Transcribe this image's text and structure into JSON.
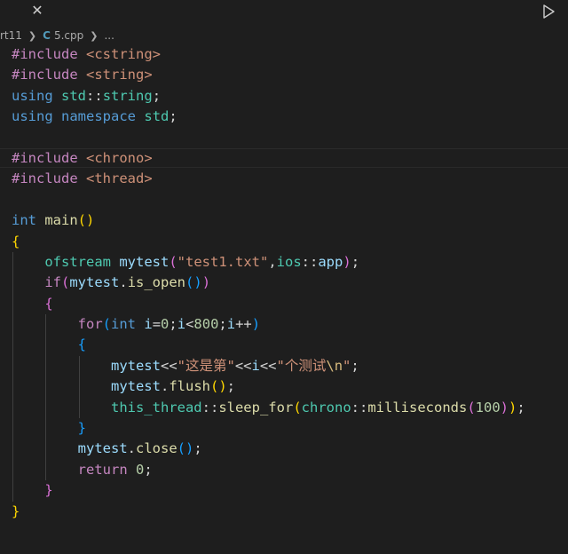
{
  "tabbar": {
    "close_glyph": "✕",
    "run_icon": "run-triangle-icon"
  },
  "breadcrumb": {
    "folder": "rt11",
    "file_icon": "C",
    "file": "5.cpp",
    "ellipsis": "..."
  },
  "colors": {
    "background": "#1e1e1e",
    "preprocessor": "#c586c0",
    "include_path": "#ce9178",
    "keyword": "#569cd6",
    "type": "#4ec9b0",
    "function": "#dcdcaa",
    "variable": "#9cdcfe",
    "string": "#ce9178",
    "number": "#b5cea8",
    "bracket_level1": "#ffd700",
    "bracket_level2": "#da70d6",
    "bracket_level3": "#179fff"
  },
  "code": {
    "lines": [
      [
        {
          "t": "#include",
          "c": "pp"
        },
        {
          "t": " ",
          "c": "op"
        },
        {
          "t": "<cstring>",
          "c": "inc"
        }
      ],
      [
        {
          "t": "#include",
          "c": "pp"
        },
        {
          "t": " ",
          "c": "op"
        },
        {
          "t": "<string>",
          "c": "inc"
        }
      ],
      [
        {
          "t": "using",
          "c": "kw"
        },
        {
          "t": " ",
          "c": "op"
        },
        {
          "t": "std",
          "c": "type"
        },
        {
          "t": "::",
          "c": "op"
        },
        {
          "t": "string",
          "c": "type"
        },
        {
          "t": ";",
          "c": "op"
        }
      ],
      [
        {
          "t": "using",
          "c": "kw"
        },
        {
          "t": " ",
          "c": "op"
        },
        {
          "t": "namespace",
          "c": "kw"
        },
        {
          "t": " ",
          "c": "op"
        },
        {
          "t": "std",
          "c": "type"
        },
        {
          "t": ";",
          "c": "op"
        }
      ],
      [],
      [
        {
          "t": "#include",
          "c": "pp"
        },
        {
          "t": " ",
          "c": "op"
        },
        {
          "t": "<chrono>",
          "c": "inc"
        }
      ],
      [
        {
          "t": "#include",
          "c": "pp"
        },
        {
          "t": " ",
          "c": "op"
        },
        {
          "t": "<thread>",
          "c": "inc"
        }
      ],
      [],
      [
        {
          "t": "int",
          "c": "kw"
        },
        {
          "t": " ",
          "c": "op"
        },
        {
          "t": "main",
          "c": "fn"
        },
        {
          "t": "()",
          "c": "b1"
        }
      ],
      [
        {
          "t": "{",
          "c": "b1"
        }
      ],
      [
        {
          "t": "    ",
          "c": "op"
        },
        {
          "t": "ofstream",
          "c": "type"
        },
        {
          "t": " ",
          "c": "op"
        },
        {
          "t": "mytest",
          "c": "var"
        },
        {
          "t": "(",
          "c": "b2"
        },
        {
          "t": "\"test1.txt\"",
          "c": "str"
        },
        {
          "t": ",",
          "c": "op"
        },
        {
          "t": "ios",
          "c": "type"
        },
        {
          "t": "::",
          "c": "op"
        },
        {
          "t": "app",
          "c": "var"
        },
        {
          "t": ")",
          "c": "b2"
        },
        {
          "t": ";",
          "c": "op"
        }
      ],
      [
        {
          "t": "    ",
          "c": "op"
        },
        {
          "t": "if",
          "c": "ctrl"
        },
        {
          "t": "(",
          "c": "b2"
        },
        {
          "t": "mytest",
          "c": "var"
        },
        {
          "t": ".",
          "c": "op"
        },
        {
          "t": "is_open",
          "c": "fn"
        },
        {
          "t": "()",
          "c": "b3"
        },
        {
          "t": ")",
          "c": "b2"
        }
      ],
      [
        {
          "t": "    ",
          "c": "op"
        },
        {
          "t": "{",
          "c": "b2"
        }
      ],
      [
        {
          "t": "        ",
          "c": "op"
        },
        {
          "t": "for",
          "c": "ctrl"
        },
        {
          "t": "(",
          "c": "b3"
        },
        {
          "t": "int",
          "c": "kw"
        },
        {
          "t": " ",
          "c": "op"
        },
        {
          "t": "i",
          "c": "var"
        },
        {
          "t": "=",
          "c": "op"
        },
        {
          "t": "0",
          "c": "num"
        },
        {
          "t": ";",
          "c": "op"
        },
        {
          "t": "i",
          "c": "var"
        },
        {
          "t": "<",
          "c": "op"
        },
        {
          "t": "800",
          "c": "num"
        },
        {
          "t": ";",
          "c": "op"
        },
        {
          "t": "i",
          "c": "var"
        },
        {
          "t": "++",
          "c": "op"
        },
        {
          "t": ")",
          "c": "b3"
        }
      ],
      [
        {
          "t": "        ",
          "c": "op"
        },
        {
          "t": "{",
          "c": "b3"
        }
      ],
      [
        {
          "t": "            ",
          "c": "op"
        },
        {
          "t": "mytest",
          "c": "var"
        },
        {
          "t": "<<",
          "c": "op"
        },
        {
          "t": "\"这是第\"",
          "c": "str"
        },
        {
          "t": "<<",
          "c": "op"
        },
        {
          "t": "i",
          "c": "var"
        },
        {
          "t": "<<",
          "c": "op"
        },
        {
          "t": "\"个测试",
          "c": "str"
        },
        {
          "t": "\\n",
          "c": "esc"
        },
        {
          "t": "\"",
          "c": "str"
        },
        {
          "t": ";",
          "c": "op"
        }
      ],
      [
        {
          "t": "            ",
          "c": "op"
        },
        {
          "t": "mytest",
          "c": "var"
        },
        {
          "t": ".",
          "c": "op"
        },
        {
          "t": "flush",
          "c": "fn"
        },
        {
          "t": "()",
          "c": "b1"
        },
        {
          "t": ";",
          "c": "op"
        }
      ],
      [
        {
          "t": "            ",
          "c": "op"
        },
        {
          "t": "this_thread",
          "c": "type"
        },
        {
          "t": "::",
          "c": "op"
        },
        {
          "t": "sleep_for",
          "c": "fn"
        },
        {
          "t": "(",
          "c": "b1"
        },
        {
          "t": "chrono",
          "c": "type"
        },
        {
          "t": "::",
          "c": "op"
        },
        {
          "t": "milliseconds",
          "c": "fn"
        },
        {
          "t": "(",
          "c": "b2"
        },
        {
          "t": "100",
          "c": "num"
        },
        {
          "t": ")",
          "c": "b2"
        },
        {
          "t": ")",
          "c": "b1"
        },
        {
          "t": ";",
          "c": "op"
        }
      ],
      [
        {
          "t": "        ",
          "c": "op"
        },
        {
          "t": "}",
          "c": "b3"
        }
      ],
      [
        {
          "t": "        ",
          "c": "op"
        },
        {
          "t": "mytest",
          "c": "var"
        },
        {
          "t": ".",
          "c": "op"
        },
        {
          "t": "close",
          "c": "fn"
        },
        {
          "t": "()",
          "c": "b3"
        },
        {
          "t": ";",
          "c": "op"
        }
      ],
      [
        {
          "t": "        ",
          "c": "op"
        },
        {
          "t": "return",
          "c": "ctrl"
        },
        {
          "t": " ",
          "c": "op"
        },
        {
          "t": "0",
          "c": "num"
        },
        {
          "t": ";",
          "c": "op"
        }
      ],
      [
        {
          "t": "    ",
          "c": "op"
        },
        {
          "t": "}",
          "c": "b2"
        }
      ],
      [
        {
          "t": "}",
          "c": "b1"
        }
      ]
    ]
  }
}
